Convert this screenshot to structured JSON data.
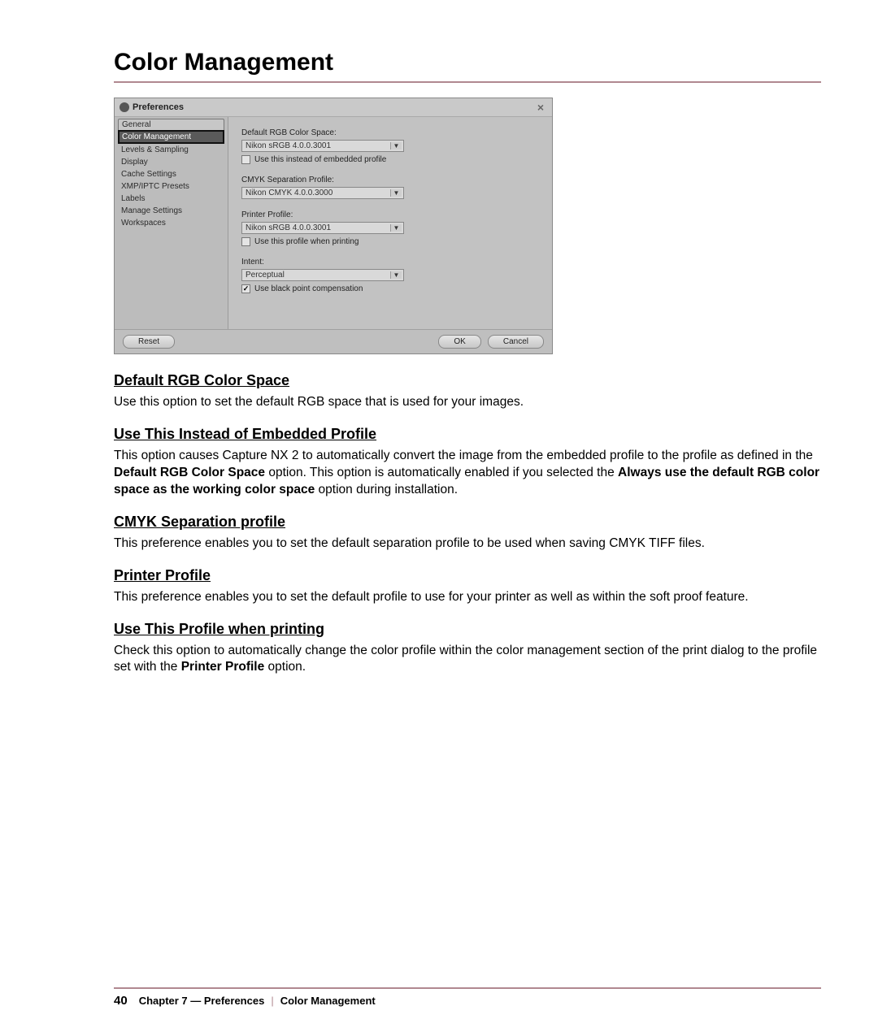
{
  "page": {
    "title": "Color Management"
  },
  "dialog": {
    "title": "Preferences",
    "close_glyph": "×",
    "sidebar": {
      "items": [
        "General",
        "Color Management",
        "Levels & Sampling",
        "Display",
        "Cache Settings",
        "XMP/IPTC Presets",
        "Labels",
        "Manage Settings",
        "Workspaces"
      ],
      "selected_index": 1
    },
    "fields": {
      "rgb": {
        "label": "Default RGB Color Space:",
        "value": "Nikon sRGB 4.0.0.3001"
      },
      "rgb_check_label": "Use this instead of embedded profile",
      "cmyk": {
        "label": "CMYK Separation Profile:",
        "value": "Nikon CMYK 4.0.0.3000"
      },
      "printer": {
        "label": "Printer Profile:",
        "value": "Nikon sRGB 4.0.0.3001"
      },
      "printer_check_label": "Use this profile when printing",
      "intent": {
        "label": "Intent:",
        "value": "Perceptual"
      },
      "bpc_check_label": "Use black point compensation"
    },
    "buttons": {
      "reset": "Reset",
      "ok": "OK",
      "cancel": "Cancel"
    }
  },
  "sections": {
    "rgb": {
      "heading": "Default RGB Color Space",
      "body": "Use this option to set the default RGB space that is used for your images."
    },
    "embed": {
      "heading": "Use This Instead of Embedded Profile",
      "body_a": "This option causes Capture NX 2 to automatically convert the image from the embedded profile to the profile as defined in the ",
      "bold_a": "Default RGB Color Space",
      "body_b": " option. This option is automatically enabled if you selected the ",
      "bold_b": "Always use the default RGB color space as the working color space",
      "body_c": " option during installation."
    },
    "cmyk": {
      "heading": "CMYK Separation profile",
      "body": "This preference enables you to set the default separation profile to be used when saving CMYK TIFF files."
    },
    "printer": {
      "heading": "Printer Profile",
      "body": "This preference enables you to set the default profile to use for your printer as well as within the soft proof feature."
    },
    "use_print": {
      "heading": "Use This Profile when printing",
      "body_a": "Check this option to automatically change the color profile within the color management section of the print dialog to the profile set with the ",
      "bold_a": "Printer Profile",
      "body_b": " option."
    }
  },
  "footer": {
    "page_number": "40",
    "chapter": "Chapter 7 — Preferences",
    "divider": "|",
    "topic": "Color Management"
  }
}
